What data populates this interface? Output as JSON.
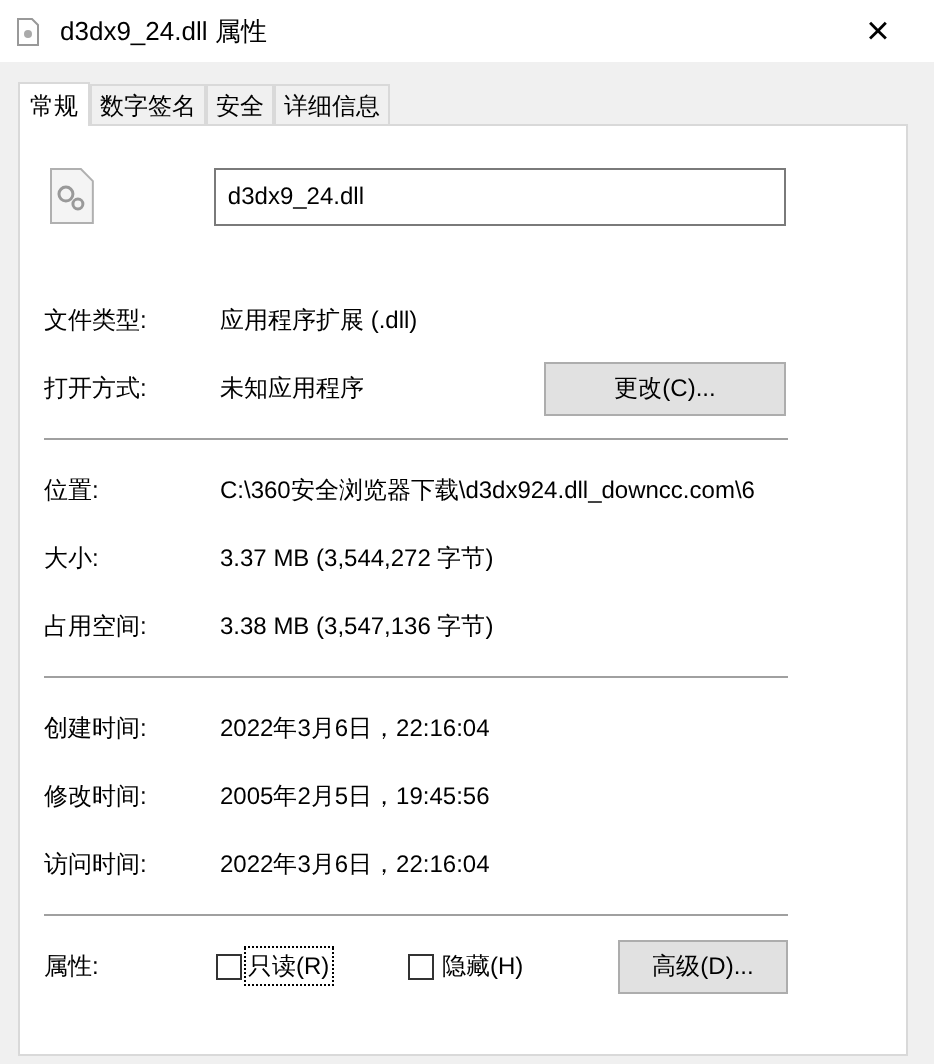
{
  "window": {
    "title": "d3dx9_24.dll 属性",
    "close": "×"
  },
  "tabs": [
    {
      "label": "常规",
      "selected": true
    },
    {
      "label": "数字签名",
      "selected": false
    },
    {
      "label": "安全",
      "selected": false
    },
    {
      "label": "详细信息",
      "selected": false
    }
  ],
  "file_name": "d3dx9_24.dll",
  "sections": [
    [
      {
        "label": "文件类型:",
        "value": "应用程序扩展 (.dll)"
      },
      {
        "label": "打开方式:",
        "value": "未知应用程序",
        "button": "更改(C)..."
      }
    ],
    [
      {
        "label": "位置:",
        "value": "C:\\360安全浏览器下载\\d3dx924.dll_downcc.com\\6"
      },
      {
        "label": "大小:",
        "value": "3.37 MB (3,544,272 字节)"
      },
      {
        "label": "占用空间:",
        "value": "3.38 MB (3,547,136 字节)"
      }
    ],
    [
      {
        "label": "创建时间:",
        "value": "2022年3月6日，22:16:04"
      },
      {
        "label": "修改时间:",
        "value": "2005年2月5日，19:45:56"
      },
      {
        "label": "访问时间:",
        "value": "2022年3月6日，22:16:04"
      }
    ]
  ],
  "attributes": {
    "label": "属性:",
    "checkboxes": [
      {
        "label": "只读(R)",
        "checked": false,
        "focused": true
      },
      {
        "label": "隐藏(H)",
        "checked": false,
        "focused": false
      }
    ],
    "button": "高级(D)..."
  }
}
